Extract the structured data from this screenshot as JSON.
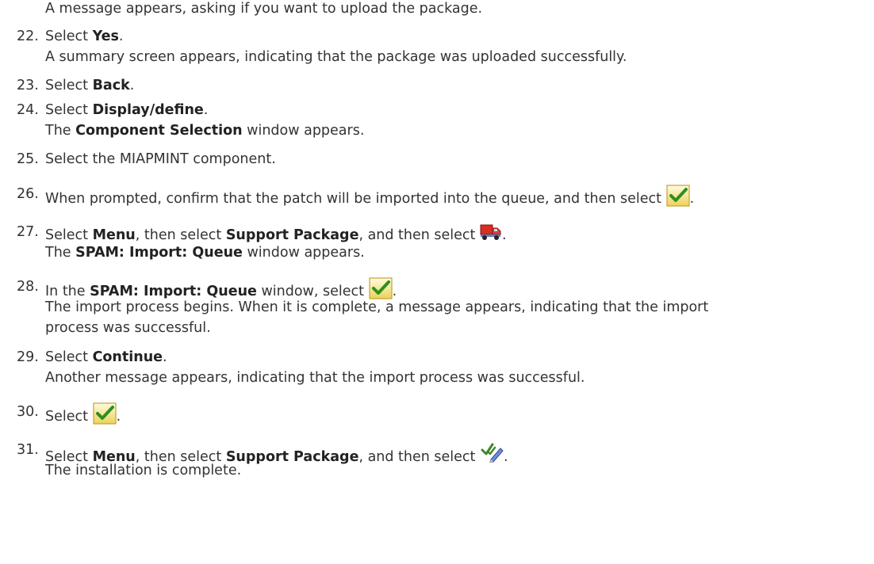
{
  "document": {
    "intro": "A message appears, asking if you want to upload the package.",
    "steps": [
      {
        "number": "22.",
        "pre": "Select ",
        "bold": "Yes",
        "post": ".",
        "result": "A summary screen appears, indicating that the package was uploaded successfully."
      },
      {
        "number": "23.",
        "pre": "Select ",
        "bold": "Back",
        "post": "."
      },
      {
        "number": "24.",
        "pre": "Select ",
        "bold": "Display/define",
        "post": ".",
        "result_bold": "Component Selection",
        "result_post": " window appears.",
        "result_pre": "The "
      },
      {
        "number": "25.",
        "text": "Select the MIAPMINT component."
      },
      {
        "number": "26.",
        "text": "When prompted, confirm that the patch will be imported into the queue, and then select ",
        "icon": "green-checkmark-icon",
        "post": "."
      },
      {
        "number": "27.",
        "pre": "Select ",
        "bold1": "Menu",
        "mid1": ", then select ",
        "bold2": "Support Package",
        "mid2": ", and then select ",
        "icon": "red-truck-import-icon",
        "post": ".",
        "result_pre": "The ",
        "result_bold": "SPAM: Import: Queue",
        "result_post": " window appears."
      },
      {
        "number": "28.",
        "pre": "In the ",
        "bold": "SPAM: Import: Queue",
        "mid": " window, select ",
        "icon": "green-checkmark-icon",
        "post": ".",
        "result1": "The import process begins. When it is complete, a message appears, indicating that the import",
        "result2": "process was successful."
      },
      {
        "number": "29.",
        "pre": "Select ",
        "bold": "Continue",
        "post": ".",
        "result": "Another message appears, indicating that the import process was successful."
      },
      {
        "number": "30.",
        "pre": "Select ",
        "icon": "green-checkmark-icon",
        "post": "."
      },
      {
        "number": "31.",
        "pre": "Select ",
        "bold1": "Menu",
        "mid1": ", then select ",
        "bold2": "Support Package",
        "mid2": ", and then select ",
        "icon": "confirm-queue-icon",
        "post": ".",
        "result": "The installation is complete."
      }
    ]
  }
}
